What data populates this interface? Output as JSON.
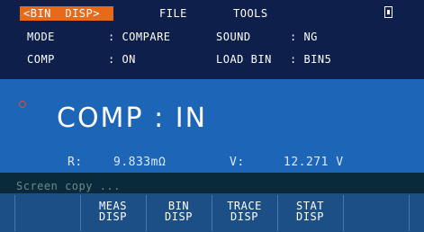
{
  "header": {
    "active_tab": "<BIN  DISP>",
    "menus": [
      "FILE",
      "TOOLS"
    ],
    "usb_icon": "usb-drive-icon",
    "rows": [
      {
        "label1": "MODE",
        "value1": ": COMPARE",
        "label2": "SOUND",
        "value2": ": NG"
      },
      {
        "label1": "COMP",
        "value1": ": ON",
        "label2": "LOAD BIN",
        "value2": ": BIN5"
      }
    ]
  },
  "main": {
    "alarm_icon": "alarm-circle-icon",
    "comp_result": "COMP : IN",
    "r_label": "R:",
    "r_value": "9.833mΩ",
    "v_label": "V:",
    "v_value": "12.271 V"
  },
  "status": {
    "text": "Screen copy ..."
  },
  "softkeys": [
    {
      "line1": "",
      "line2": ""
    },
    {
      "line1": "MEAS",
      "line2": "DISP"
    },
    {
      "line1": "BIN",
      "line2": "DISP"
    },
    {
      "line1": "TRACE",
      "line2": "DISP"
    },
    {
      "line1": "STAT",
      "line2": "DISP"
    },
    {
      "line1": "",
      "line2": ""
    }
  ],
  "colors": {
    "header_bg": "#0d1f4a",
    "tab_accent": "#e86a18",
    "main_bg": "#1c65b7",
    "softkey_bg": "#1c4f86",
    "status_bg": "#082a3a"
  }
}
